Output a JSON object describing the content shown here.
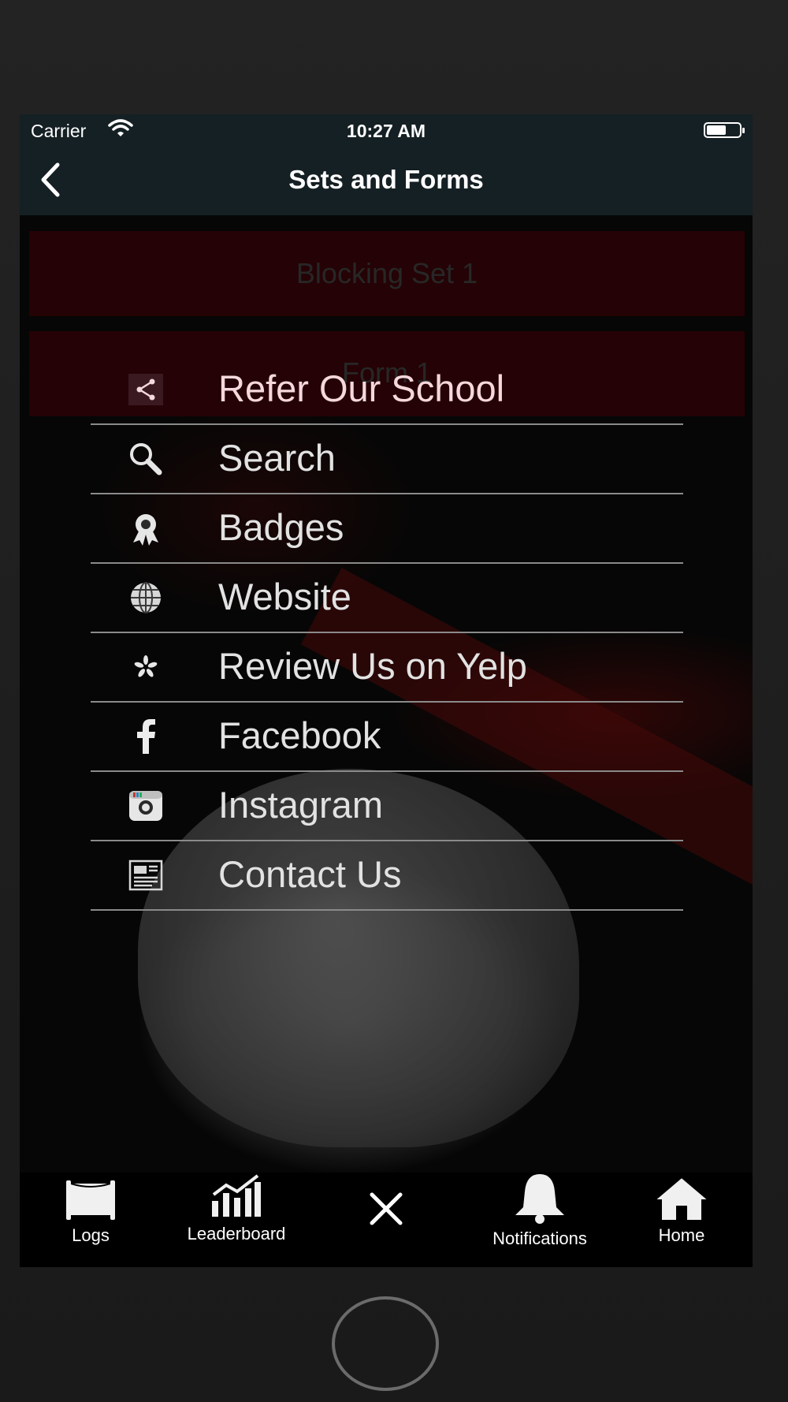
{
  "status_bar": {
    "carrier": "Carrier",
    "time": "10:27 AM"
  },
  "nav": {
    "title": "Sets and Forms"
  },
  "list": [
    {
      "label": "Blocking Set 1"
    },
    {
      "label": "Form 1"
    }
  ],
  "menu": [
    {
      "label": "Refer Our School",
      "icon": "share-icon"
    },
    {
      "label": "Search",
      "icon": "search-icon"
    },
    {
      "label": "Badges",
      "icon": "badge-icon"
    },
    {
      "label": "Website",
      "icon": "globe-icon"
    },
    {
      "label": "Review Us on Yelp",
      "icon": "yelp-icon"
    },
    {
      "label": "Facebook",
      "icon": "facebook-icon"
    },
    {
      "label": "Instagram",
      "icon": "instagram-icon"
    },
    {
      "label": "Contact Us",
      "icon": "newspaper-icon"
    }
  ],
  "tabs": [
    {
      "label": "Logs",
      "icon": "scroll-icon"
    },
    {
      "label": "Leaderboard",
      "icon": "bar-chart-icon"
    },
    {
      "label": "",
      "icon": "close-icon"
    },
    {
      "label": "Notifications",
      "icon": "bell-icon"
    },
    {
      "label": "Home",
      "icon": "home-icon"
    }
  ],
  "colors": {
    "nav_bg": "#152024",
    "list_button_bg": "#3a0408",
    "tab_bar_bg": "#000000"
  }
}
